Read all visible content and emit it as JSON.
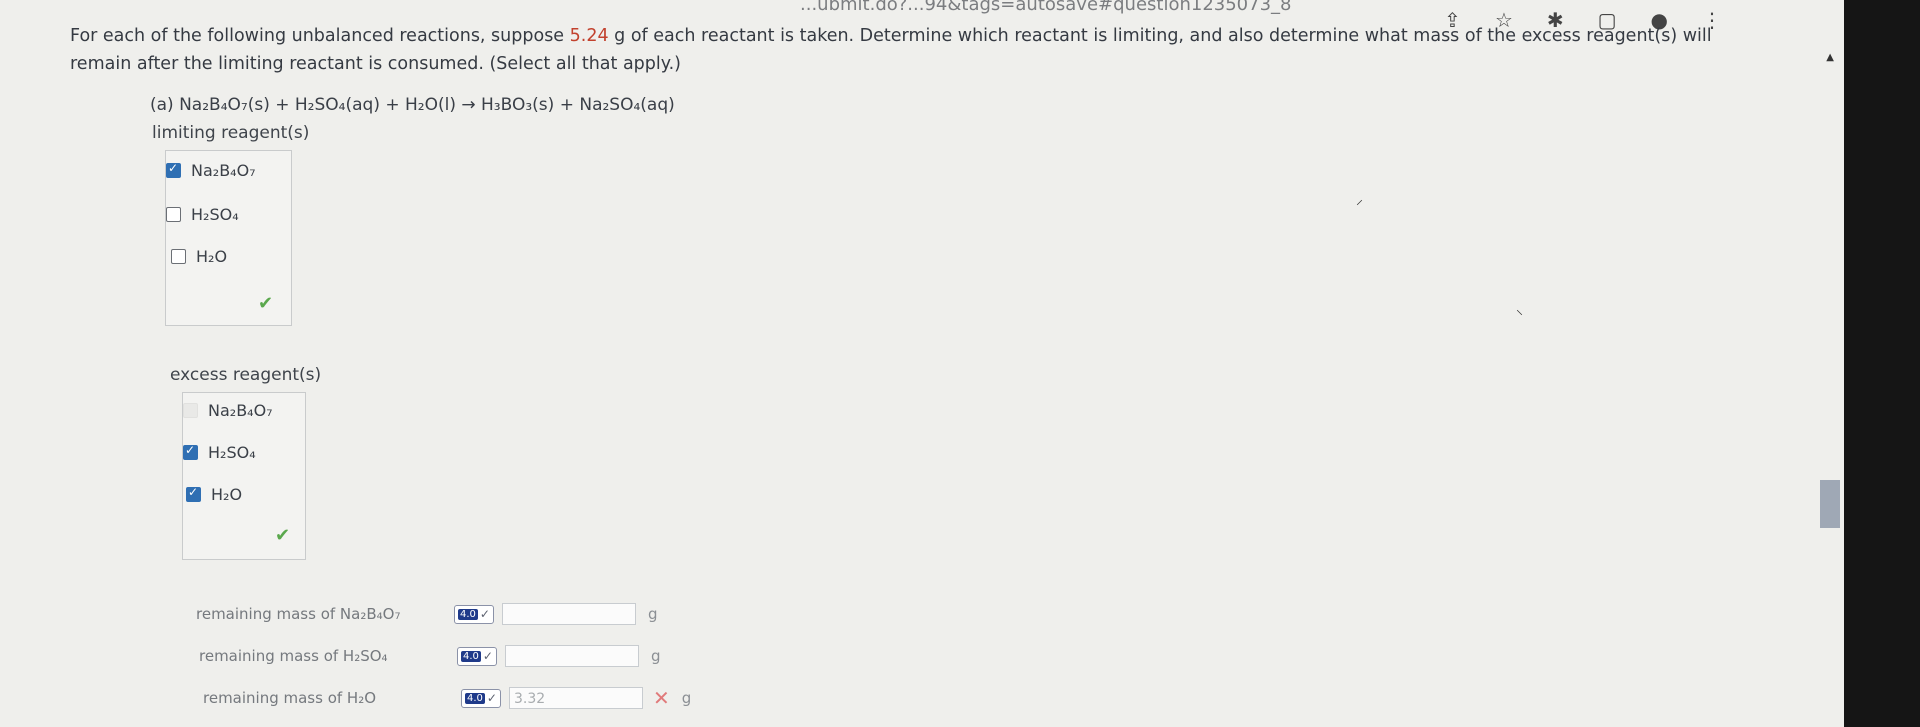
{
  "browser": {
    "url_fragment": "...ubmit.do?...94&tags=autosave#question1235073_8"
  },
  "question": {
    "prompt_before": "For each of the following unbalanced reactions, suppose ",
    "mass_value": "5.24",
    "prompt_after": " g of each reactant is taken. Determine which reactant is limiting, and also determine what mass of the excess reagent(s) will remain after the limiting reactant is consumed. (Select all that apply.)",
    "part_label": "(a)",
    "equation": "Na₂B₄O₇(s) + H₂SO₄(aq) + H₂O(l) → H₃BO₃(s) + Na₂SO₄(aq)"
  },
  "limiting": {
    "label": "limiting reagent(s)",
    "options": [
      {
        "label": "Na₂B₄O₇",
        "checked": true
      },
      {
        "label": "H₂SO₄",
        "checked": false
      },
      {
        "label": "H₂O",
        "checked": false
      }
    ],
    "status": "correct"
  },
  "excess": {
    "label": "excess reagent(s)",
    "options": [
      {
        "label": "Na₂B₄O₇",
        "checked": false,
        "disabled": true
      },
      {
        "label": "H₂SO₄",
        "checked": true
      },
      {
        "label": "H₂O",
        "checked": true
      }
    ],
    "status": "correct"
  },
  "masses": [
    {
      "label": "remaining mass of Na₂B₄O₇",
      "badge": "4.0",
      "value": "",
      "unit": "g",
      "status": ""
    },
    {
      "label": "remaining mass of H₂SO₄",
      "badge": "4.0",
      "value": "",
      "unit": "g",
      "status": ""
    },
    {
      "label": "remaining mass of H₂O",
      "badge": "4.0",
      "value": "3.32",
      "unit": "g",
      "status": "wrong"
    }
  ],
  "icons": {
    "share": "share-icon",
    "star": "star-icon",
    "extension": "extension-icon",
    "window": "window-icon",
    "profile": "profile-icon",
    "menu": "kebab-menu-icon"
  }
}
